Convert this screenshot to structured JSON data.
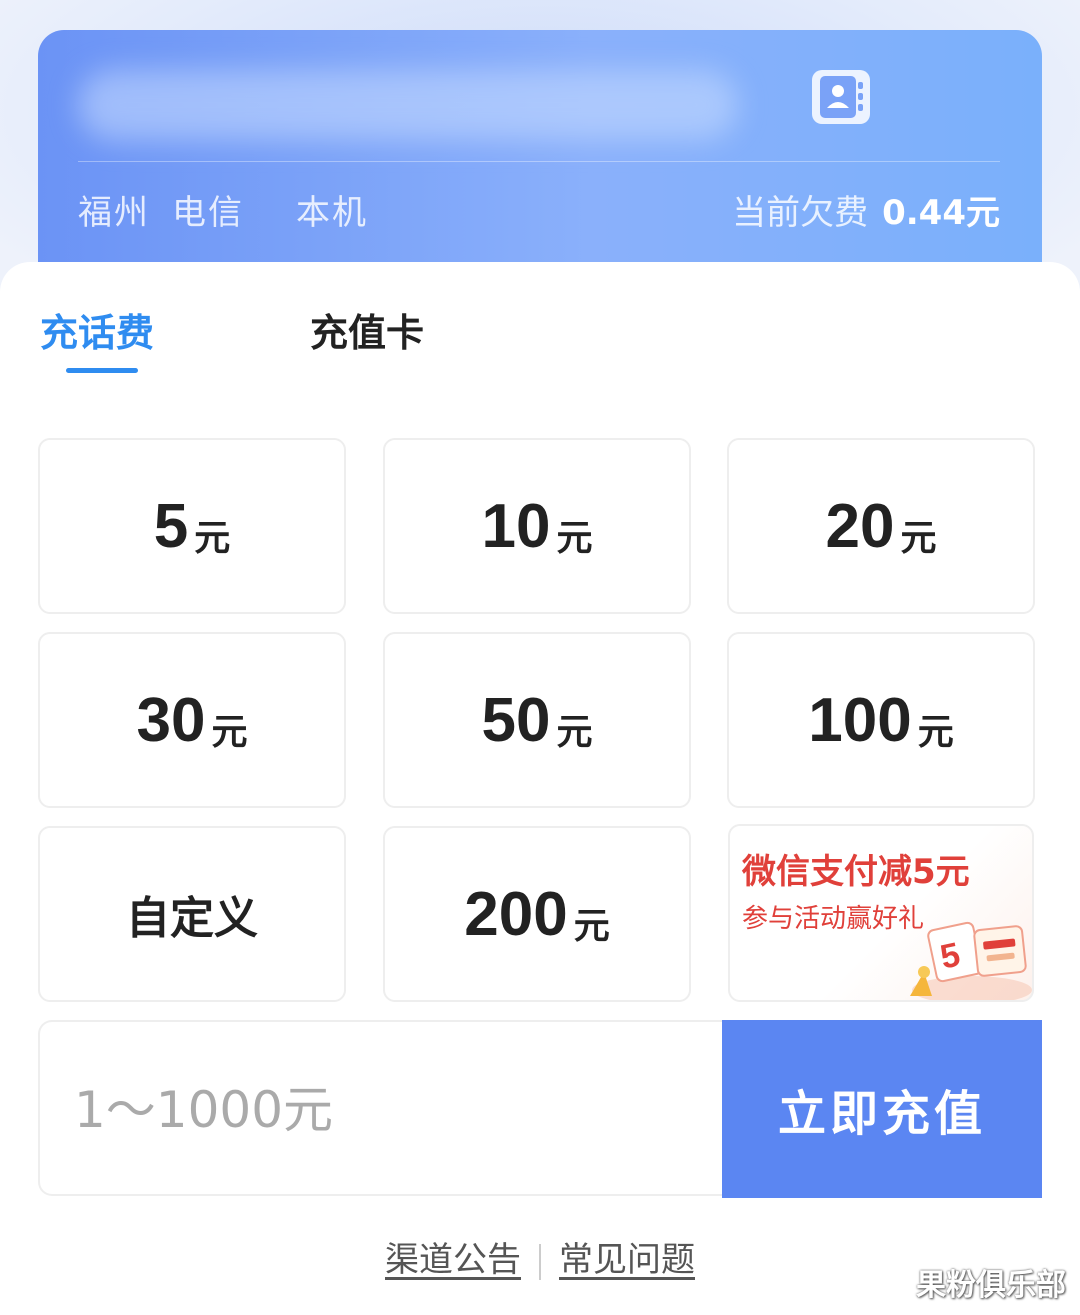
{
  "header": {
    "carrier_city": "福州",
    "carrier_name": "电信",
    "line_label": "本机",
    "balance_label": "当前欠费",
    "balance_amount": "0.44元",
    "contact_icon": "contact-book-icon"
  },
  "tabs": [
    {
      "label": "充话费",
      "active": true
    },
    {
      "label": "充值卡",
      "active": false
    }
  ],
  "amounts": [
    {
      "value": "5",
      "unit": "元"
    },
    {
      "value": "10",
      "unit": "元"
    },
    {
      "value": "20",
      "unit": "元"
    },
    {
      "value": "30",
      "unit": "元"
    },
    {
      "value": "50",
      "unit": "元"
    },
    {
      "value": "100",
      "unit": "元"
    },
    {
      "custom_label": "自定义"
    },
    {
      "value": "200",
      "unit": "元"
    }
  ],
  "promo": {
    "title": "微信支付减5元",
    "subtitle": "参与活动赢好礼"
  },
  "custom_amount": {
    "placeholder": "1～1000元"
  },
  "pay_button_label": "立即充值",
  "footer": {
    "announcement_link": "渠道公告",
    "faq_link": "常见问题"
  },
  "watermark": "果粉俱乐部",
  "colors": {
    "accent_blue": "#2f8cf0",
    "button_blue": "#5b86f2",
    "promo_red": "#e0403a"
  }
}
